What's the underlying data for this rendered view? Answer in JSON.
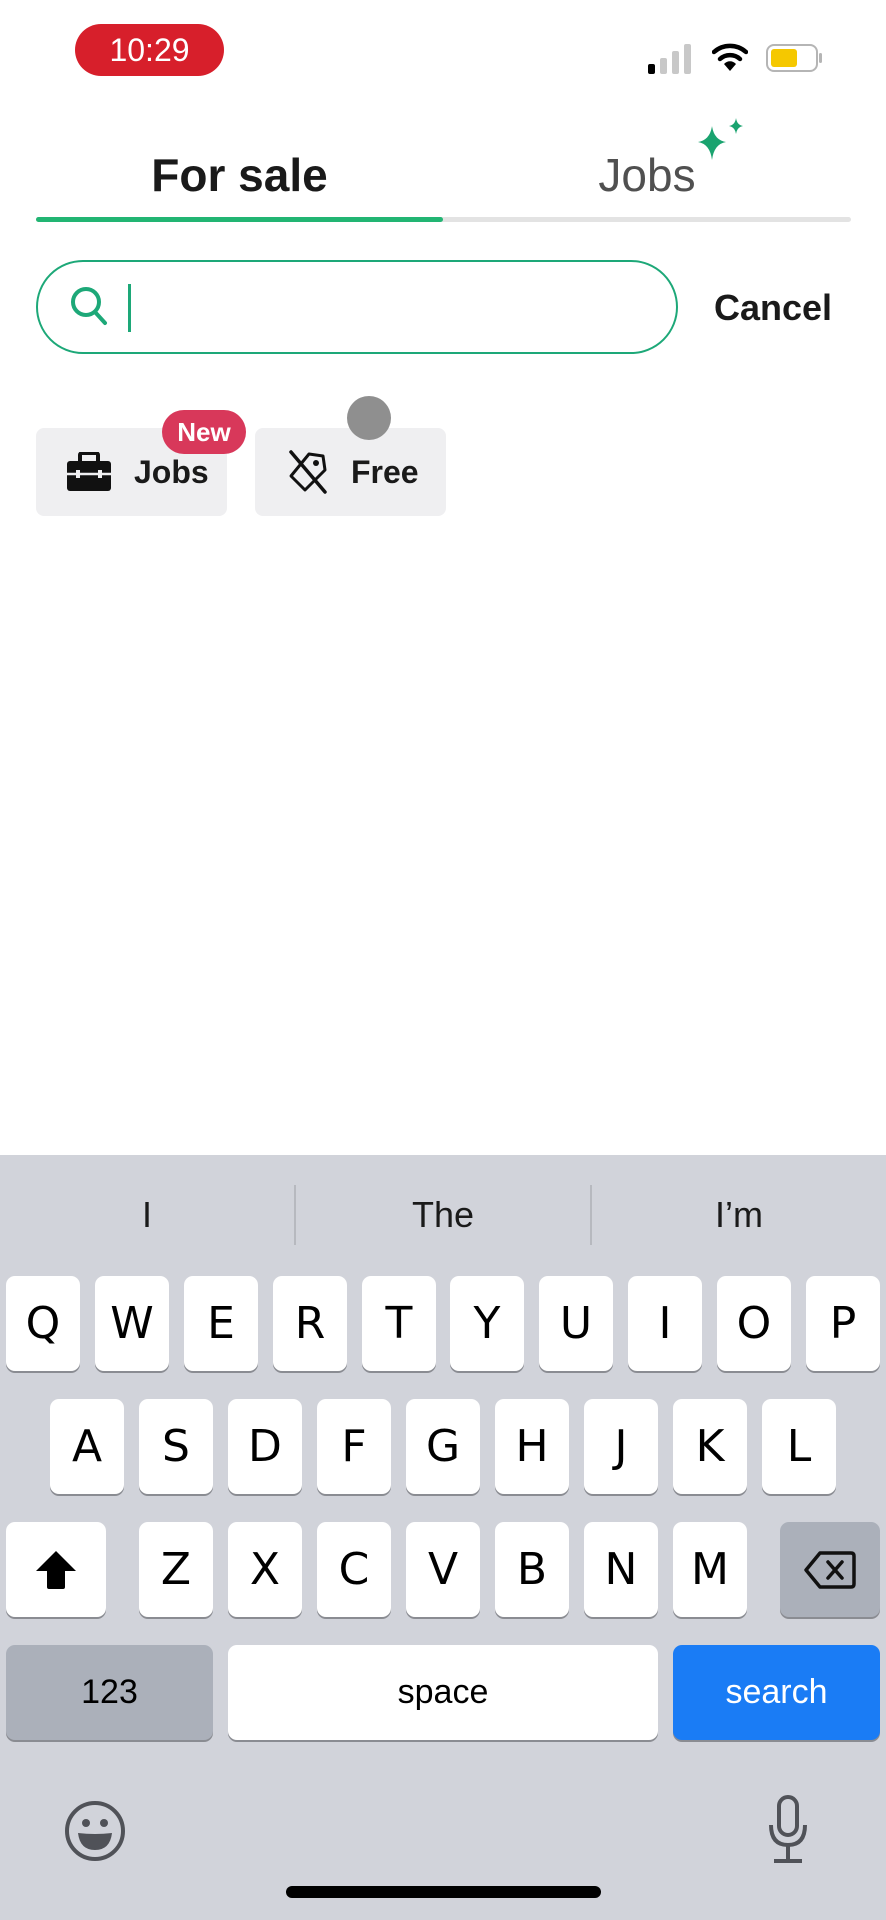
{
  "status_bar": {
    "time": "10:29",
    "time_pill_color": "#d71f2b",
    "signal_bars_active": 1,
    "signal_bars_total": 4,
    "battery_color": "#f5c800"
  },
  "tabs": [
    {
      "label": "For sale",
      "active": true
    },
    {
      "label": "Jobs",
      "active": false,
      "badge_icon": "sparkle-icon"
    }
  ],
  "accent_color": "#22b573",
  "search": {
    "value": "",
    "placeholder": "",
    "cancel_label": "Cancel"
  },
  "chips": [
    {
      "label": "Jobs",
      "icon": "briefcase-icon",
      "badge": "New"
    },
    {
      "label": "Free",
      "icon": "no-price-tag-icon"
    }
  ],
  "keyboard": {
    "suggestions": [
      "I",
      "The",
      "I’m"
    ],
    "row1": [
      "Q",
      "W",
      "E",
      "R",
      "T",
      "Y",
      "U",
      "I",
      "O",
      "P"
    ],
    "row2": [
      "A",
      "S",
      "D",
      "F",
      "G",
      "H",
      "J",
      "K",
      "L"
    ],
    "row3": [
      "Z",
      "X",
      "C",
      "V",
      "B",
      "N",
      "M"
    ],
    "numbers_label": "123",
    "space_label": "space",
    "action_label": "search",
    "action_color": "#1a7cf5"
  }
}
